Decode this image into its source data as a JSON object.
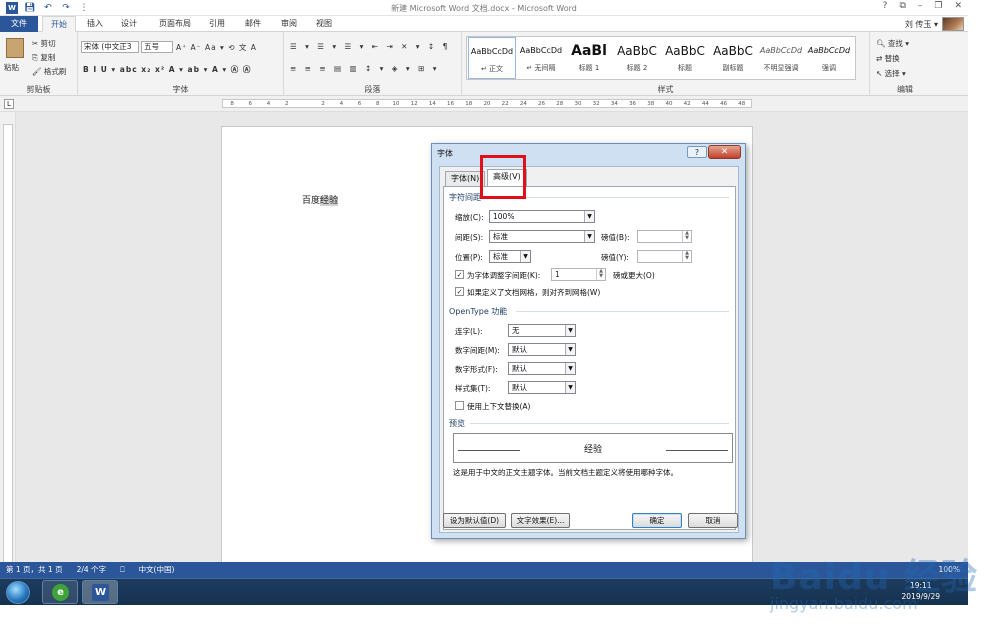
{
  "window": {
    "title": "新建 Microsoft Word 文档.docx - Microsoft Word",
    "controls": [
      "?",
      "⧉",
      "–",
      "⧉",
      "✕"
    ]
  },
  "quick_access": {
    "icons": [
      "save-icon",
      "undo-icon",
      "redo-icon",
      "customize-icon"
    ]
  },
  "tabs": [
    "文件",
    "开始",
    "插入",
    "设计",
    "页面布局",
    "引用",
    "邮件",
    "审阅",
    "视图"
  ],
  "active_tab": "开始",
  "user": {
    "name": "刘 传玉 ▾"
  },
  "ribbon": {
    "clipboard": {
      "paste": "粘贴",
      "cut": "剪切",
      "copy": "复制",
      "format_painter": "格式刷",
      "label": "剪贴板"
    },
    "font": {
      "name": "宋体 (中文正3",
      "size": "五号",
      "label": "字体",
      "buttons_row1": "A⁺ A⁻  Aa ▾   ⟲ 文 A",
      "buttons_row2": "B  I  U ▾  abc  x₂  x²   A ▾ ab ▾ A ▾ Ⓐ Ⓐ"
    },
    "paragraph": {
      "label": "段落"
    },
    "styles": {
      "label": "样式",
      "items": [
        {
          "preview": "AaBbCcDd",
          "name": "↵ 正文"
        },
        {
          "preview": "AaBbCcDd",
          "name": "↵ 无间隔"
        },
        {
          "preview": "AaBl",
          "name": "标题 1"
        },
        {
          "preview": "AaBbC",
          "name": "标题 2"
        },
        {
          "preview": "AaBbC",
          "name": "标题"
        },
        {
          "preview": "AaBbC",
          "name": "副标题"
        },
        {
          "preview": "AaBbCcDd",
          "name": "不明显强调"
        },
        {
          "preview": "AaBbCcDd",
          "name": "强调"
        }
      ]
    },
    "editing": {
      "find": "查找 ▾",
      "replace": "替换",
      "select": "选择 ▾",
      "label": "编辑"
    }
  },
  "ruler": {
    "ticks": [
      "8",
      "6",
      "4",
      "2",
      "",
      "2",
      "4",
      "6",
      "8",
      "10",
      "12",
      "14",
      "16",
      "18",
      "20",
      "22",
      "24",
      "26",
      "28",
      "30",
      "32",
      "34",
      "36",
      "38",
      "40",
      "42",
      "44",
      "46",
      "48"
    ]
  },
  "document": {
    "text_plain": "百度",
    "text_highlight": "经验"
  },
  "status_bar": {
    "page": "第 1 页，共 1 页",
    "words": "2/4 个字",
    "lang": "中文(中国)",
    "zoom": "100%"
  },
  "taskbar": {
    "time": "19:11",
    "date": "2019/9/29"
  },
  "watermark": {
    "brand": "Baidu 经验",
    "url": "jingyan.baidu.com"
  },
  "dialog": {
    "title": "字体",
    "help": "?",
    "close": "✕",
    "tabs": [
      "字体(N)",
      "高级(V)"
    ],
    "active_tab": "高级(V)",
    "spacing_section": "字符间距",
    "scale_label": "缩放(C):",
    "scale_value": "100%",
    "spacing_label": "间距(S):",
    "spacing_value": "标准",
    "spacing_by_label": "磅值(B):",
    "spacing_by_value": "",
    "position_label": "位置(P):",
    "position_value": "标准",
    "position_by_label": "磅值(Y):",
    "position_by_value": "",
    "kerning_label": "为字体调整字间距(K):",
    "kerning_checked": true,
    "kerning_value": "1",
    "kerning_suffix": "磅或更大(O)",
    "grid_label": "如果定义了文档网格，则对齐到网格(W)",
    "grid_checked": true,
    "opentype_section": "OpenType 功能",
    "ligatures_label": "连字(L):",
    "ligatures_value": "无",
    "num_spacing_label": "数字间距(M):",
    "num_spacing_value": "默认",
    "num_forms_label": "数字形式(F):",
    "num_forms_value": "默认",
    "stylistic_label": "样式集(T):",
    "stylistic_value": "默认",
    "contextual_label": "使用上下文替换(A)",
    "contextual_checked": false,
    "preview_section": "预览",
    "preview_text": "经验",
    "note": "这是用于中文的正文主题字体。当前文档主题定义将使用哪种字体。",
    "btn_default": "设为默认值(D)",
    "btn_effects": "文字效果(E)...",
    "btn_ok": "确定",
    "btn_cancel": "取消"
  }
}
